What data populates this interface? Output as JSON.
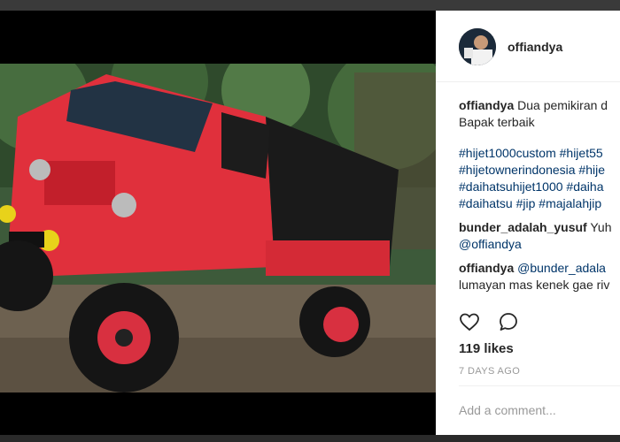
{
  "post": {
    "author": "offiandya",
    "likes": "119 likes",
    "timestamp": "7 DAYS AGO",
    "add_comment_placeholder": "Add a comment..."
  },
  "comments": [
    {
      "user": "offiandya",
      "line1": "Dua pemikiran d",
      "line2": "Bapak terbaik"
    },
    {
      "tags": [
        "#hijet1000custom #hijet55",
        "#hijetownerindonesia #hije",
        "#daihatsuhijet1000 #daiha",
        "#daihatsu #jip #majalahjip"
      ]
    },
    {
      "user": "bunder_adalah_yusuf",
      "text": "Yuh",
      "mention": "@offiandya"
    },
    {
      "user": "offiandya",
      "mention": "@bunder_adala",
      "line2": "lumayan mas kenek gae riv"
    }
  ],
  "icons": {
    "like": "heart-icon",
    "comment": "comment-bubble-icon"
  },
  "colors": {
    "link": "#003569",
    "text": "#262626",
    "muted": "#999999"
  }
}
